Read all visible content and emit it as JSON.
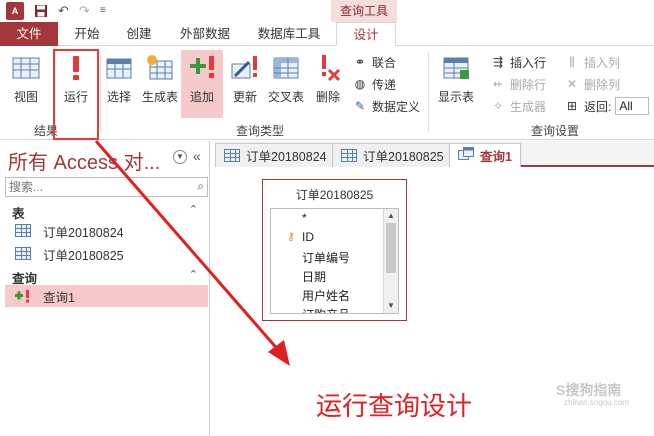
{
  "titlebar": {
    "app_icon_text": "A",
    "undo": "↶",
    "redo": "↷",
    "customize": "≡",
    "context_tab_label": "查询工具"
  },
  "tabs": {
    "file": "文件",
    "home": "开始",
    "create": "创建",
    "external": "外部数据",
    "dbtools": "数据库工具",
    "design": "设计"
  },
  "ribbon": {
    "view": "视图",
    "run": "运行",
    "select": "选择",
    "make_table": "生成表",
    "append": "追加",
    "update": "更新",
    "crosstab": "交叉表",
    "delete": "删除",
    "union": "联合",
    "passthrough": "传递",
    "data_definition": "数据定义",
    "show_table": "显示表",
    "insert_row": "插入行",
    "delete_row": "删除行",
    "builder": "生成器",
    "insert_col": "插入列",
    "delete_col": "删除列",
    "return_label": "返回:",
    "return_value": "All",
    "group_results": "结果",
    "group_query_type": "查询类型",
    "group_query_setup": "查询设置"
  },
  "nav": {
    "title": "所有 Access 对...",
    "search_placeholder": "搜索...",
    "sections": [
      {
        "label": "表",
        "toggle": "⌃"
      },
      {
        "label": "查询",
        "toggle": "⌃"
      }
    ],
    "tables": [
      "订单20180824",
      "订单20180825"
    ],
    "queries": [
      "查询1"
    ]
  },
  "doc_tabs": [
    "订单20180824",
    "订单20180825",
    "查询1"
  ],
  "field_list": {
    "title": "订单20180825",
    "fields": [
      "*",
      "ID",
      "订单编号",
      "日期",
      "用户姓名",
      "订购产品"
    ]
  },
  "annotation": "运行查询设计",
  "watermark": {
    "main": "S搜狗指南",
    "sub": "zhinan.sogou.com"
  },
  "colors": {
    "access_red": "#a4373a",
    "annotation_red": "#e02020",
    "highlight_pink": "#f6c9cb"
  }
}
